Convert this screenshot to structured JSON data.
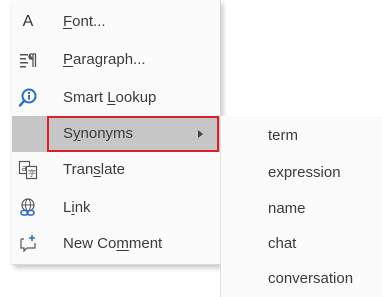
{
  "context_menu": {
    "items": [
      {
        "label_before": "",
        "accel": "F",
        "label_after": "ont...",
        "icon": "font-icon"
      },
      {
        "label_before": "",
        "accel": "P",
        "label_after": "aragraph...",
        "icon": "paragraph-icon"
      },
      {
        "label_before": "Smart ",
        "accel": "L",
        "label_after": "ookup",
        "icon": "smart-lookup-icon"
      },
      {
        "label_before": "S",
        "accel": "y",
        "label_after": "nonyms",
        "icon": ""
      },
      {
        "label_before": "Tran",
        "accel": "s",
        "label_after": "late",
        "icon": "translate-icon"
      },
      {
        "label_before": "L",
        "accel": "i",
        "label_after": "nk",
        "icon": "link-icon"
      },
      {
        "label_before": "New Co",
        "accel": "m",
        "label_after": "ment",
        "icon": "new-comment-icon"
      }
    ],
    "font_icon_glyph": "A"
  },
  "synonyms_submenu": {
    "items": [
      "term",
      "expression",
      "name",
      "chat",
      "conversation"
    ]
  },
  "colors": {
    "highlight": "#c6c6c6",
    "red_outline": "#d6232b",
    "accent_blue": "#2b6cc4"
  }
}
